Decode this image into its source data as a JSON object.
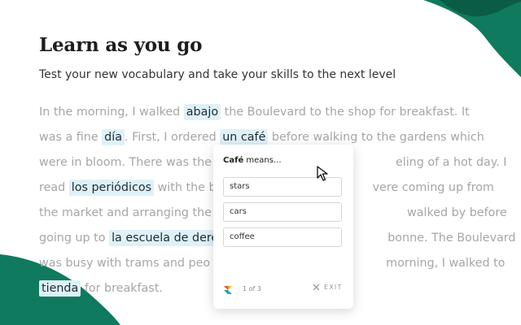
{
  "heading": {
    "title": "Learn as you go",
    "subtitle": "Test your new vocabulary and take your skills to the next level"
  },
  "story": {
    "line1": {
      "a": "In the morning, I walked ",
      "v1": "abajo",
      "b": " the Boulevard to the shop for breakfast. It"
    },
    "line2": {
      "a": "was a fine ",
      "v1": "día",
      "b": ". First, I ordered ",
      "v2": "un café",
      "c": " before walking to the gardens which"
    },
    "line3": {
      "a": "were in bloom. There was the",
      "b": "eling of a hot day. I"
    },
    "line4": {
      "a": "read ",
      "v1": "los periódicos",
      "b": " with the b",
      "c": "vere coming up from"
    },
    "line5": {
      "a": "the market and arranging the",
      "b": "walked by before"
    },
    "line6": {
      "a": "going up to ",
      "v1": "la escuela de dere",
      "b": "bonne. The Boulevard"
    },
    "line7": {
      "a": "was busy with trams and peo",
      "b": "morning, I walked to"
    },
    "line8": {
      "v1": "tienda",
      "b": " for breakfast."
    }
  },
  "quiz": {
    "word": "Café",
    "prompt_suffix": " means...",
    "options": [
      "stars",
      "cars",
      "coffee"
    ],
    "progress": "1 of 3",
    "exit_label": "EXIT"
  },
  "colors": {
    "teal": "#0f7a5e",
    "teal_dark": "#0b5c47",
    "highlight": "#dff1f8"
  },
  "icons": [
    "pointer-cursor-icon",
    "close-icon",
    "app-logo-icon"
  ]
}
